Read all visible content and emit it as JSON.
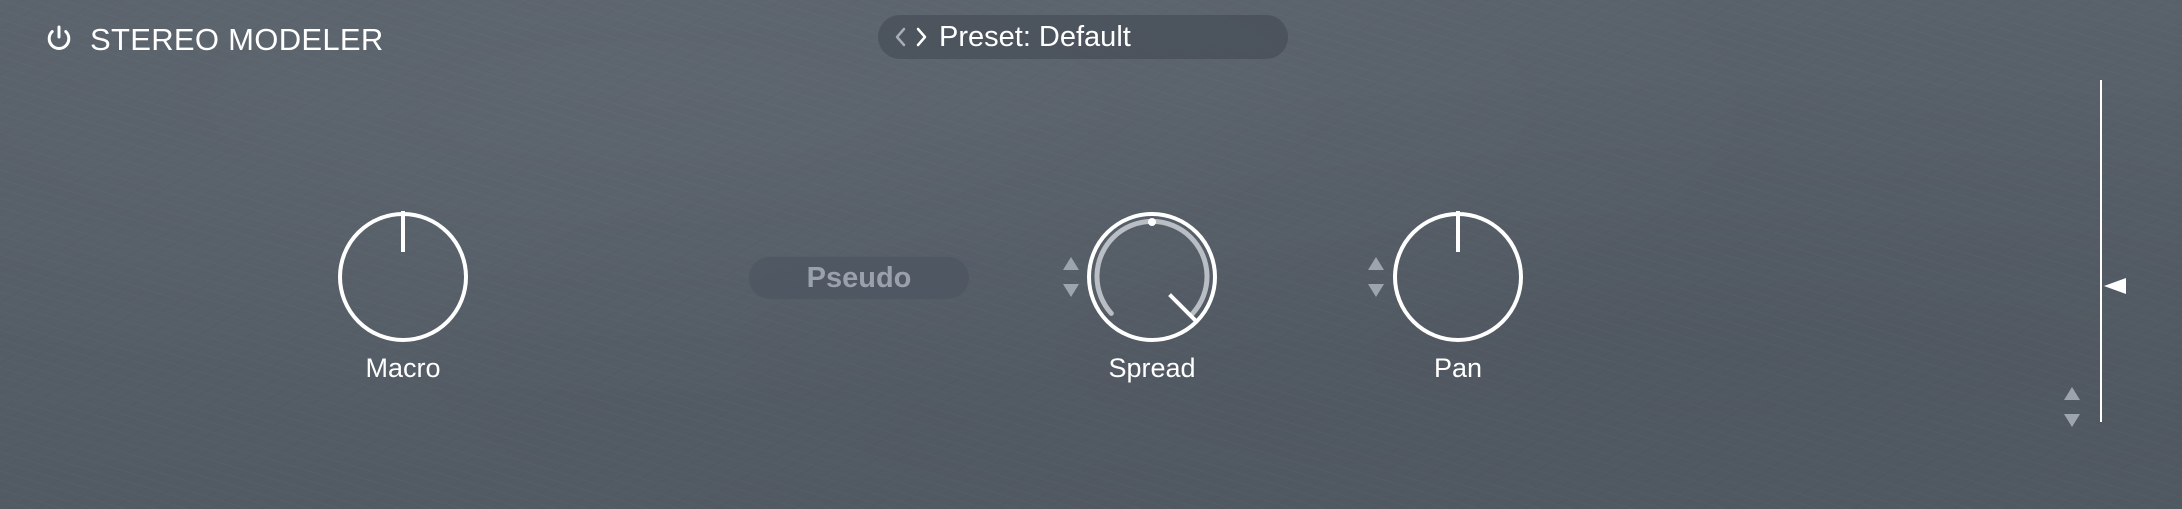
{
  "header": {
    "title": "STEREO MODELER",
    "power_icon": "power-icon",
    "preset": {
      "label": "Preset: Default",
      "prev_icon": "chevron-left-icon",
      "next_icon": "chevron-right-icon"
    }
  },
  "controls": {
    "mode_button": "Pseudo",
    "knobs": [
      {
        "label": "Macro",
        "value": 0.5
      },
      {
        "label": "Spread",
        "value": 0.875
      },
      {
        "label": "Pan",
        "value": 0.5
      }
    ],
    "stepper_icons": [
      "triangle-up-icon",
      "triangle-down-icon"
    ]
  },
  "meter": {
    "level": 0.4
  },
  "colors": {
    "background": "#555d67",
    "foreground": "#ffffff",
    "muted_text": "#9aa1aa",
    "track": "#b9bec5"
  }
}
